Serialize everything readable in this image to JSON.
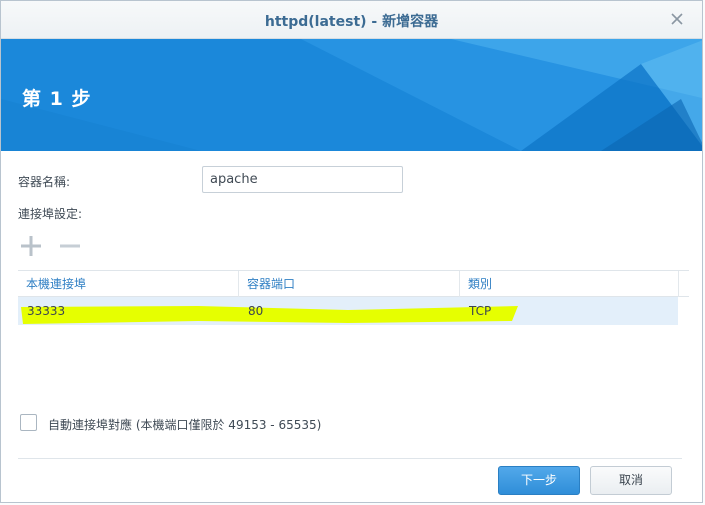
{
  "window": {
    "title": "httpd(latest) - 新增容器"
  },
  "banner": {
    "step": "第 1 步"
  },
  "form": {
    "container_name_label": "容器名稱:",
    "container_name_value": "apache",
    "port_settings_label": "連接埠設定:"
  },
  "toolbar": {
    "add_icon": "plus-icon",
    "remove_icon": "minus-icon"
  },
  "port_table": {
    "columns": [
      "本機連接埠",
      "容器端口",
      "類別"
    ],
    "rows": [
      [
        "33333",
        "80",
        "TCP"
      ]
    ]
  },
  "auto_port": {
    "checked": false,
    "label": "自動連接埠對應 (本機端口僅限於 49153 - 65535)"
  },
  "buttons": {
    "next": "下一步",
    "cancel": "取消"
  },
  "colors": {
    "accent": "#1a86d8",
    "title_text": "#3c6b93",
    "highlight": "#e6ff00"
  }
}
